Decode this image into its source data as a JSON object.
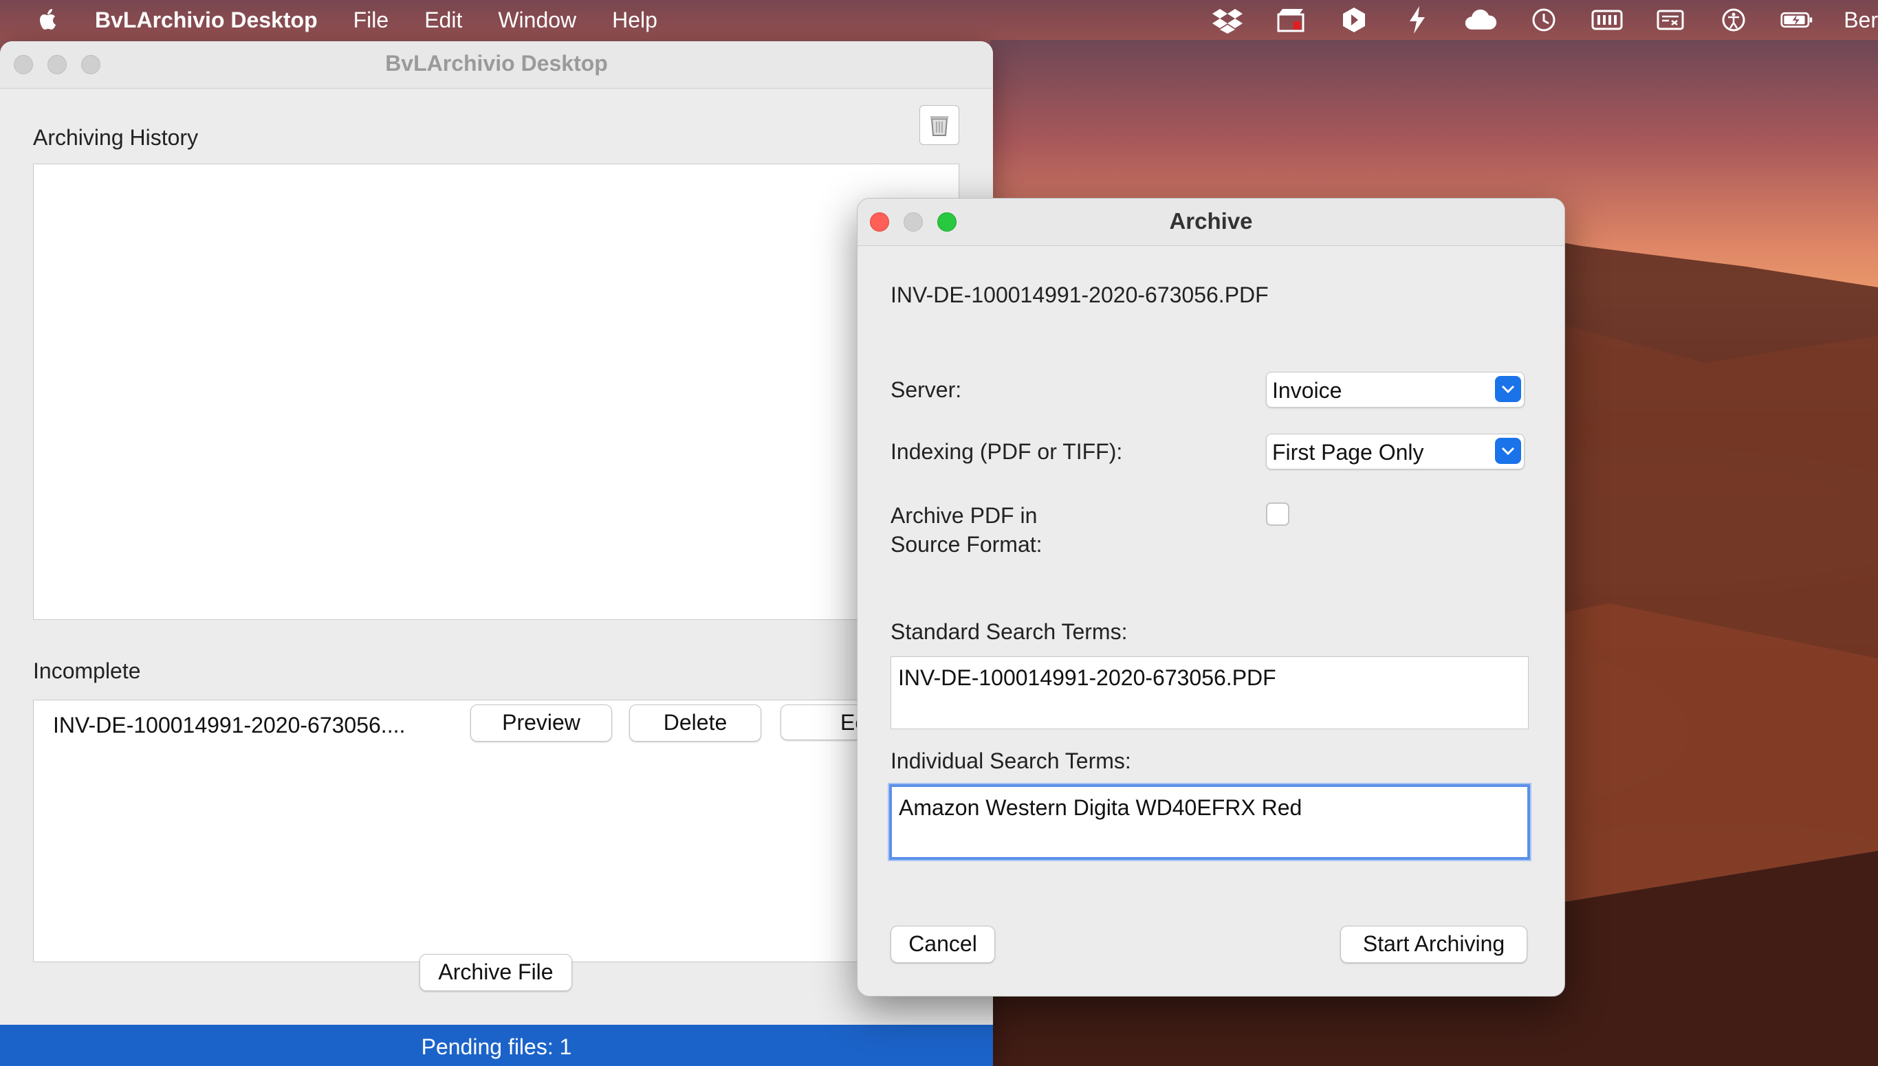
{
  "menubar": {
    "app_name": "BvLArchivio Desktop",
    "items": [
      "File",
      "Edit",
      "Window",
      "Help"
    ],
    "tray_icons": [
      "dropbox-icon",
      "clapper-icon",
      "arrow-app-icon",
      "bolt-icon",
      "cloud-icon",
      "time-machine-icon",
      "ram-icon",
      "keyboard-icon",
      "accessibility-icon",
      "battery-icon"
    ],
    "user": "Ber"
  },
  "main_window": {
    "title": "BvLArchivio Desktop",
    "history_label": "Archiving History",
    "incomplete_label": "Incomplete",
    "incomplete_items": [
      {
        "filename": "INV-DE-100014991-2020-673056....",
        "preview": "Preview",
        "delete": "Delete",
        "edit": "Ec"
      }
    ],
    "archive_button": "Archive File",
    "status": "Pending files:   1"
  },
  "dialog": {
    "title": "Archive",
    "filename": "INV-DE-100014991-2020-673056.PDF",
    "server_label": "Server:",
    "server_value": "Invoice",
    "indexing_label": "Indexing (PDF or TIFF):",
    "indexing_value": "First Page Only",
    "archive_pdf_label_line1": "Archive PDF in",
    "archive_pdf_label_line2": "Source Format:",
    "archive_pdf_checked": false,
    "standard_terms_label": "Standard Search Terms:",
    "standard_terms_value": "INV-DE-100014991-2020-673056.PDF",
    "individual_terms_label": "Individual Search Terms:",
    "individual_terms_value": "Amazon Western Digita WD40EFRX Red",
    "cancel": "Cancel",
    "start": "Start Archiving"
  },
  "colors": {
    "accent": "#1a73e8",
    "status_bar": "#1c63c9",
    "close": "#ff5f57",
    "minimize_inactive": "#cfcfcf",
    "zoom": "#28c840"
  }
}
